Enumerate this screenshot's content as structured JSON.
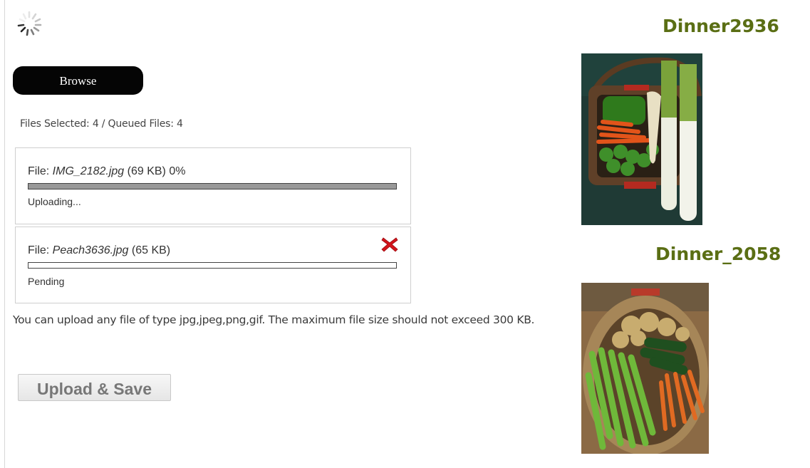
{
  "uploader": {
    "browse_label": "Browse",
    "files_status": "Files Selected: 4 / Queued Files: 4",
    "files": [
      {
        "prefix": "File: ",
        "name": "IMG_2182.jpg",
        "size": " (69 KB)",
        "percent_text": " 0%",
        "progress": 1.0,
        "status": "Uploading..."
      },
      {
        "prefix": "File: ",
        "name": "Peach3636.jpg",
        "size": " (65 KB)",
        "percent_text": "",
        "progress": 0.0,
        "status": "Pending",
        "remove_icon": "close-x-icon"
      }
    ],
    "help_text": "You can upload any file of type jpg,jpeg,png,gif. The maximum file size should not exceed 300 KB.",
    "upload_label": "Upload & Save",
    "spinner_icon": "loading-spinner-icon"
  },
  "gallery": {
    "items": [
      {
        "title": "Dinner2936",
        "image": "vegetable-basket-photo"
      },
      {
        "title": "Dinner_2058",
        "image": "vegetable-basket-photo"
      }
    ],
    "title_color": "#5a6e14"
  }
}
